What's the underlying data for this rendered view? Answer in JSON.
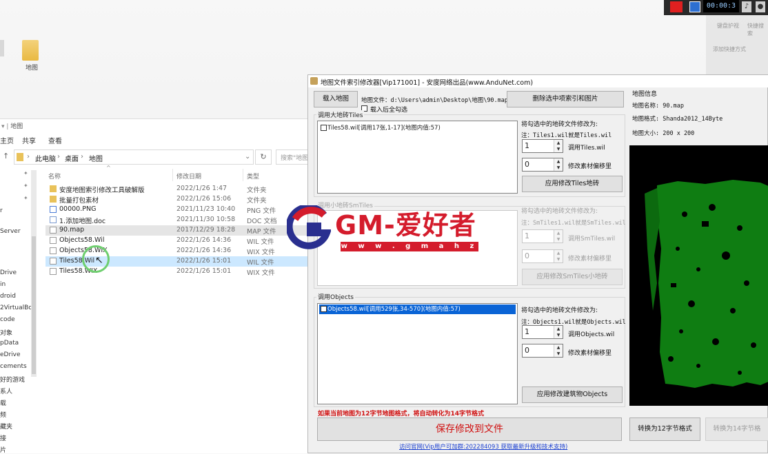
{
  "desktop": {
    "icon_label": "地图"
  },
  "recorder": {
    "time": "00:00:3"
  },
  "side_panel": {
    "item1": "键盘护视",
    "item2": "快捷搜索",
    "item3": "添加快捷方式"
  },
  "explorer": {
    "title": "地图",
    "ribbon": [
      "主页",
      "共享",
      "查看"
    ],
    "address": [
      "此电脑",
      "桌面",
      "地图"
    ],
    "search_placeholder": "搜索\"地图\"",
    "nav_items": [
      "",
      "r",
      "Server",
      "",
      "",
      "Drive",
      "in",
      "droid",
      "2VirtualBo",
      "code",
      "对象",
      "pData",
      "eDrive",
      "cements",
      "好的游戏",
      "系人",
      "载",
      "频",
      "藏夹",
      "接",
      "片"
    ],
    "columns": {
      "name": "名称",
      "date": "修改日期",
      "type": "类型"
    },
    "files": [
      {
        "name": "安度地图索引修改工具破解版",
        "date": "2022/1/26 1:47",
        "type": "文件夹",
        "icon": "folder"
      },
      {
        "name": "批量打包素材",
        "date": "2022/1/26 15:06",
        "type": "文件夹",
        "icon": "folder"
      },
      {
        "name": "00000.PNG",
        "date": "2021/11/23 10:40",
        "type": "PNG 文件",
        "icon": "png"
      },
      {
        "name": "1.添加地图.doc",
        "date": "2021/11/30 10:58",
        "type": "DOC 文档",
        "icon": "doc"
      },
      {
        "name": "90.map",
        "date": "2017/12/29 18:28",
        "type": "MAP 文件",
        "icon": "blank"
      },
      {
        "name": "Objects58.Wil",
        "date": "2022/1/26 14:36",
        "type": "WIL 文件",
        "icon": "blank"
      },
      {
        "name": "Objects58.WIX",
        "date": "2022/1/26 14:36",
        "type": "WIX 文件",
        "icon": "blank"
      },
      {
        "name": "Tiles58.Wil",
        "date": "2022/1/26 15:01",
        "type": "WIL 文件",
        "icon": "blank"
      },
      {
        "name": "Tiles58.WIX",
        "date": "2022/1/26 15:01",
        "type": "WIX 文件",
        "icon": "blank"
      }
    ]
  },
  "tool": {
    "title": "地图文件索引修改器[Vip171001] - 安度网络出品(www.AnduNet.com)",
    "load_map_button": "载入地图",
    "map_file_label": "地图文件：d:\\Users\\admin\\Desktop\\地图\\90.map",
    "select_all_after_load": "载入后全勾选",
    "delete_button": "删除选中项索引和图片",
    "tiles_group": {
      "title": "调用大地砖Tiles",
      "items": [
        "Tiles58.wil[调用17张,1-17](地图内值:57)"
      ],
      "change_to": "将勾选中的地砖文件修改为:",
      "note": "注：Tiles1.wil就是Tiles.wil",
      "file_index": "1",
      "file_label": "调用Tiles.wil",
      "offset": "0",
      "offset_label": "修改素材偏移里",
      "apply_button": "应用修改Tiles地砖"
    },
    "smtiles_group": {
      "title": "调用小地砖SmTiles",
      "change_to": "将勾选中的地砖文件修改为:",
      "note": "注：SmTiles1.wil就是SmTiles.wil",
      "file_index": "1",
      "file_label": "调用SmTiles.wil",
      "offset": "0",
      "offset_label": "修改素材偏移里",
      "apply_button": "应用修改SmTiles小地砖"
    },
    "objects_group": {
      "title": "调用Objects",
      "items": [
        "Objects58.wil[调用529张,34-570](地图内值:57)"
      ],
      "change_to": "将勾选中的地砖文件修改为:",
      "note": "注：Objects1.wil就是Objects.wil",
      "file_index": "1",
      "file_label": "调用Objects.wil",
      "offset": "0",
      "offset_label": "修改素材偏移里",
      "apply_button": "应用修改建筑物Objects"
    },
    "warning": "如果当前地图为12字节地图格式，将自动转化为14字节格式",
    "save_button": "保存修改到文件",
    "convert12_button": "转换为12字节格式",
    "convert14_button": "转换为14字节格",
    "link": "访问官网(Vip用户可加群:202284093 获取最新升级和技术支持)",
    "map_info": {
      "title": "地图信息",
      "name": "地图名称: 90.map",
      "format": "地图格式: Shanda2012_14Byte",
      "size": "地图大小: 200 x 200"
    }
  },
  "watermark": {
    "text": "GM-爱好者",
    "url": "w w w . g m a h z . c o m"
  },
  "colors": {
    "selection_blue": "#0a64d6",
    "warning_red": "#d01010",
    "map_green": "#0f7d12",
    "watermark_red": "#d41c2c"
  }
}
